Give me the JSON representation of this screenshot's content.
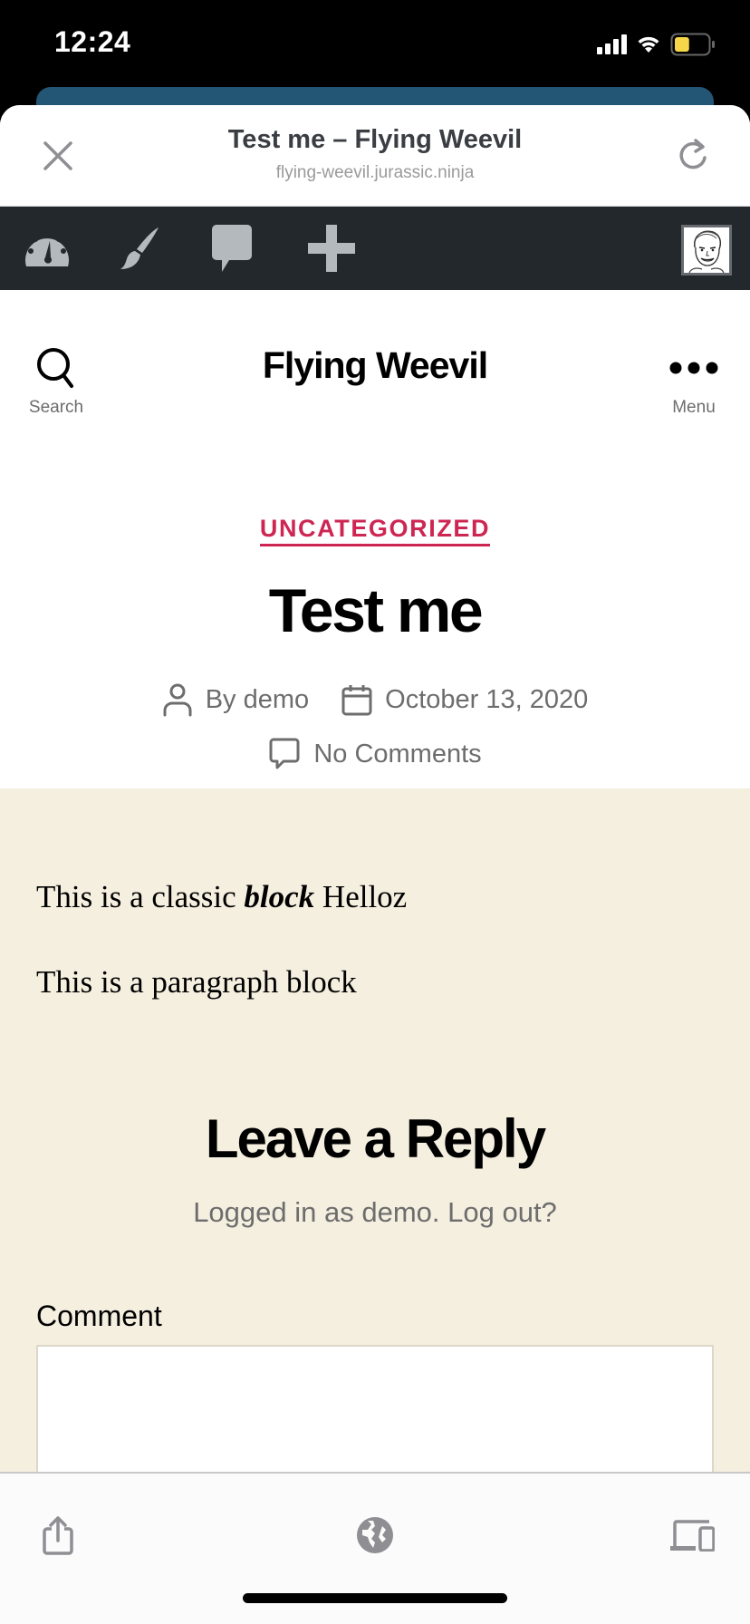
{
  "status_bar": {
    "time": "12:24",
    "battery_level": 0.45,
    "battery_color": "#f7d74a"
  },
  "browser": {
    "page_title": "Test me – Flying Weevil",
    "url": "flying-weevil.jurassic.ninja",
    "close_icon": "close-icon",
    "reload_icon": "reload-icon"
  },
  "admin_bar": {
    "items": [
      {
        "icon": "dashboard-icon",
        "label": "Dashboard"
      },
      {
        "icon": "customize-brush-icon",
        "label": "Customize"
      },
      {
        "icon": "comments-icon",
        "label": "Comments"
      },
      {
        "icon": "new-plus-icon",
        "label": "New"
      }
    ],
    "avatar": "user-avatar"
  },
  "site_header": {
    "title": "Flying Weevil",
    "search_label": "Search",
    "menu_label": "Menu"
  },
  "entry": {
    "category": "UNCATEGORIZED",
    "title": "Test me",
    "author": "By demo",
    "date": "October 13, 2020",
    "comments": "No Comments",
    "accent_color": "#cd2653"
  },
  "content": {
    "para1_before": "This is a classic ",
    "para1_bold": "block",
    "para1_after": " Helloz",
    "para2": "This is a paragraph block",
    "background": "#f5efe0"
  },
  "reply": {
    "title": "Leave a Reply",
    "logged_in_prefix": "Logged in as demo.",
    "logout_link": "Log out?",
    "comment_label": "Comment",
    "comment_value": ""
  },
  "bottom_toolbar": {
    "items": [
      {
        "icon": "share-icon"
      },
      {
        "icon": "globe-icon"
      },
      {
        "icon": "devices-icon"
      }
    ]
  }
}
